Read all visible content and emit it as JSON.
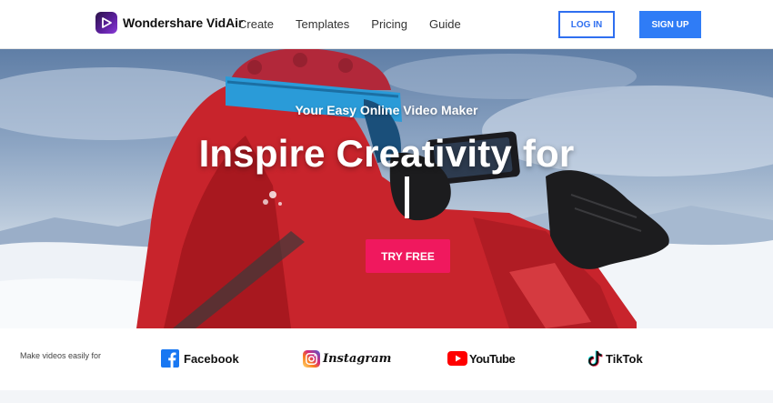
{
  "brand": {
    "name": "Wondershare VidAir"
  },
  "nav": {
    "items": [
      "Create",
      "Templates",
      "Pricing",
      "Guide"
    ]
  },
  "auth": {
    "login_label": "LOG IN",
    "signup_label": "SIGN UP"
  },
  "hero": {
    "tagline": "Your Easy Online Video Maker",
    "headline": "Inspire Creativity for",
    "cta_label": "TRY FREE"
  },
  "platforms": {
    "label": "Make videos easily for",
    "items": [
      {
        "name": "Facebook",
        "icon": "facebook-icon"
      },
      {
        "name": "Instagram",
        "icon": "instagram-icon"
      },
      {
        "name": "YouTube",
        "icon": "youtube-icon"
      },
      {
        "name": "TikTok",
        "icon": "tiktok-icon"
      }
    ]
  },
  "colors": {
    "primary_blue": "#2f7cf6",
    "cta_pink": "#f0185e",
    "brand_purple": "#5b1f9c"
  }
}
